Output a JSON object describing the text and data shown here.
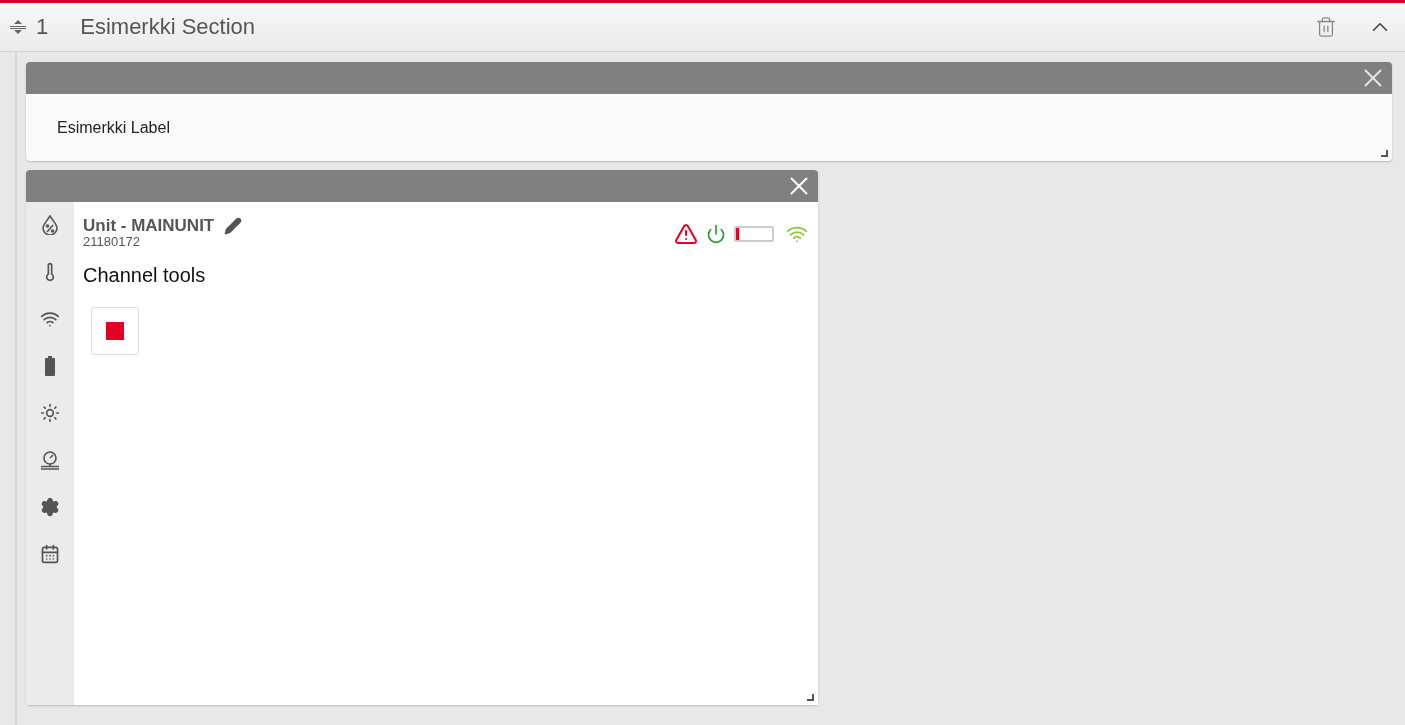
{
  "section": {
    "number": "1",
    "title": "Esimerkki Section",
    "expanded": true
  },
  "label_widget": {
    "text": "Esimerkki Label"
  },
  "unit_widget": {
    "title": "Unit - MAINUNIT",
    "serial": "21180172",
    "heading": "Channel tools",
    "sidebar": [
      {
        "kind": "humidity"
      },
      {
        "kind": "temperature"
      },
      {
        "kind": "signal"
      },
      {
        "kind": "battery"
      },
      {
        "kind": "light"
      },
      {
        "kind": "pressure"
      },
      {
        "kind": "settings"
      },
      {
        "kind": "calendar"
      }
    ],
    "status": {
      "alert": true,
      "powered": true,
      "battery": {
        "level": 0.08
      }
    },
    "tools": [
      {
        "kind": "stop"
      }
    ]
  }
}
